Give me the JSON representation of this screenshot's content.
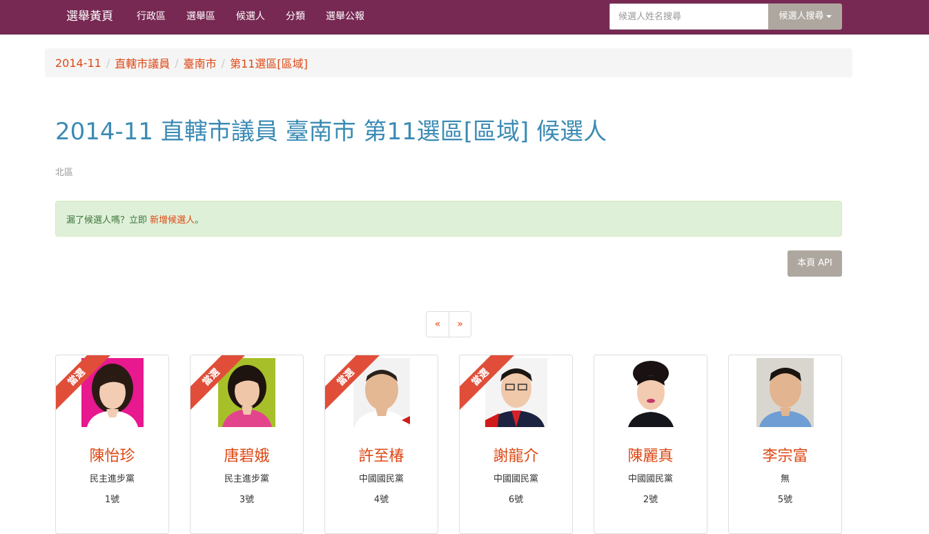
{
  "navbar": {
    "brand": "選舉黃頁",
    "links": [
      "行政區",
      "選舉區",
      "候選人",
      "分類",
      "選舉公報"
    ],
    "search_placeholder": "候選人姓名搜尋",
    "search_button": "候選人搜尋"
  },
  "breadcrumb": [
    "2014-11",
    "直轄市議員",
    "臺南市",
    "第11選區[區域]"
  ],
  "page": {
    "title": "2014-11 直轄市議員 臺南市 第11選區[區域] 候選人",
    "subtitle": "北區"
  },
  "alert": {
    "prefix": "漏了候選人嗎？立即 ",
    "link": "新增候選人",
    "suffix": "。"
  },
  "api_button": "本頁 API",
  "pagination": {
    "prev": "«",
    "next": "»"
  },
  "elected_label": "當選",
  "candidates": [
    {
      "name": "陳怡珍",
      "party": "民主進步黨",
      "number": "1號",
      "elected": true
    },
    {
      "name": "唐碧娥",
      "party": "民主進步黨",
      "number": "3號",
      "elected": true
    },
    {
      "name": "許至椿",
      "party": "中國國民黨",
      "number": "4號",
      "elected": true
    },
    {
      "name": "謝龍介",
      "party": "中國國民黨",
      "number": "6號",
      "elected": true
    },
    {
      "name": "陳麗真",
      "party": "中國國民黨",
      "number": "2號",
      "elected": false
    },
    {
      "name": "李宗富",
      "party": "無",
      "number": "5號",
      "elected": false
    }
  ],
  "colors": {
    "navbar": "#772953",
    "accent": "#dd4814",
    "title": "#3b8bb4",
    "ribbon": "#e04e39",
    "button": "#aea79f"
  }
}
